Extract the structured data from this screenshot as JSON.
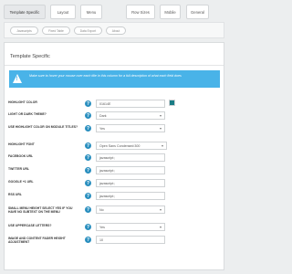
{
  "tabs": [
    {
      "label": "Template Specific",
      "active": true
    },
    {
      "label": "Layout",
      "active": false
    },
    {
      "label": "Menu",
      "active": false
    },
    {
      "label": "Row Sizes",
      "active": false
    },
    {
      "label": "Mobile",
      "active": false
    },
    {
      "label": "General",
      "active": false
    }
  ],
  "subtabs": [
    "Javascripts",
    "Fixed Table",
    "Data Export",
    "About"
  ],
  "panel": {
    "title": "Template Specific",
    "notice": "Make sure to hover your mouse over each title in this column for a full description of what each field does"
  },
  "settings": [
    {
      "label": "HIGHLIGHT COLOR",
      "value": "01614E",
      "type": "color",
      "swatch_color": "#1a7c85"
    },
    {
      "label": "LIGHT OR DARK THEME?",
      "value": "Dark",
      "type": "select"
    },
    {
      "label": "USE HIGHLIGHT COLOR ON MODULE TITLES?",
      "value": "Yes",
      "type": "select"
    },
    {
      "label": "HIGHLIGHT FONT",
      "value": "Open Sans Condensed:300",
      "type": "select"
    },
    {
      "label": "FACEBOOK URL",
      "value": "javascript:;",
      "type": "text"
    },
    {
      "label": "TWITTER URL",
      "value": "javascript:;",
      "type": "text"
    },
    {
      "label": "GOOGLE +1 URL",
      "value": "javascript:;",
      "type": "text"
    },
    {
      "label": "RSS URL",
      "value": "javascript:;",
      "type": "text"
    },
    {
      "label": "SMALL MENU HEIGHT SELECT YES IF YOU HAVE NO SUBTEXT ON THE MENU",
      "value": "No",
      "type": "select"
    },
    {
      "label": "USE UPPERCASE LETTERS?",
      "value": "Yes",
      "type": "select"
    },
    {
      "label": "IMAGE AND CONTENT FADER HEIGHT ADJUSTMENT",
      "value": "10",
      "type": "text"
    }
  ],
  "icons": {
    "help": "help-icon",
    "notice": "warning-icon"
  }
}
